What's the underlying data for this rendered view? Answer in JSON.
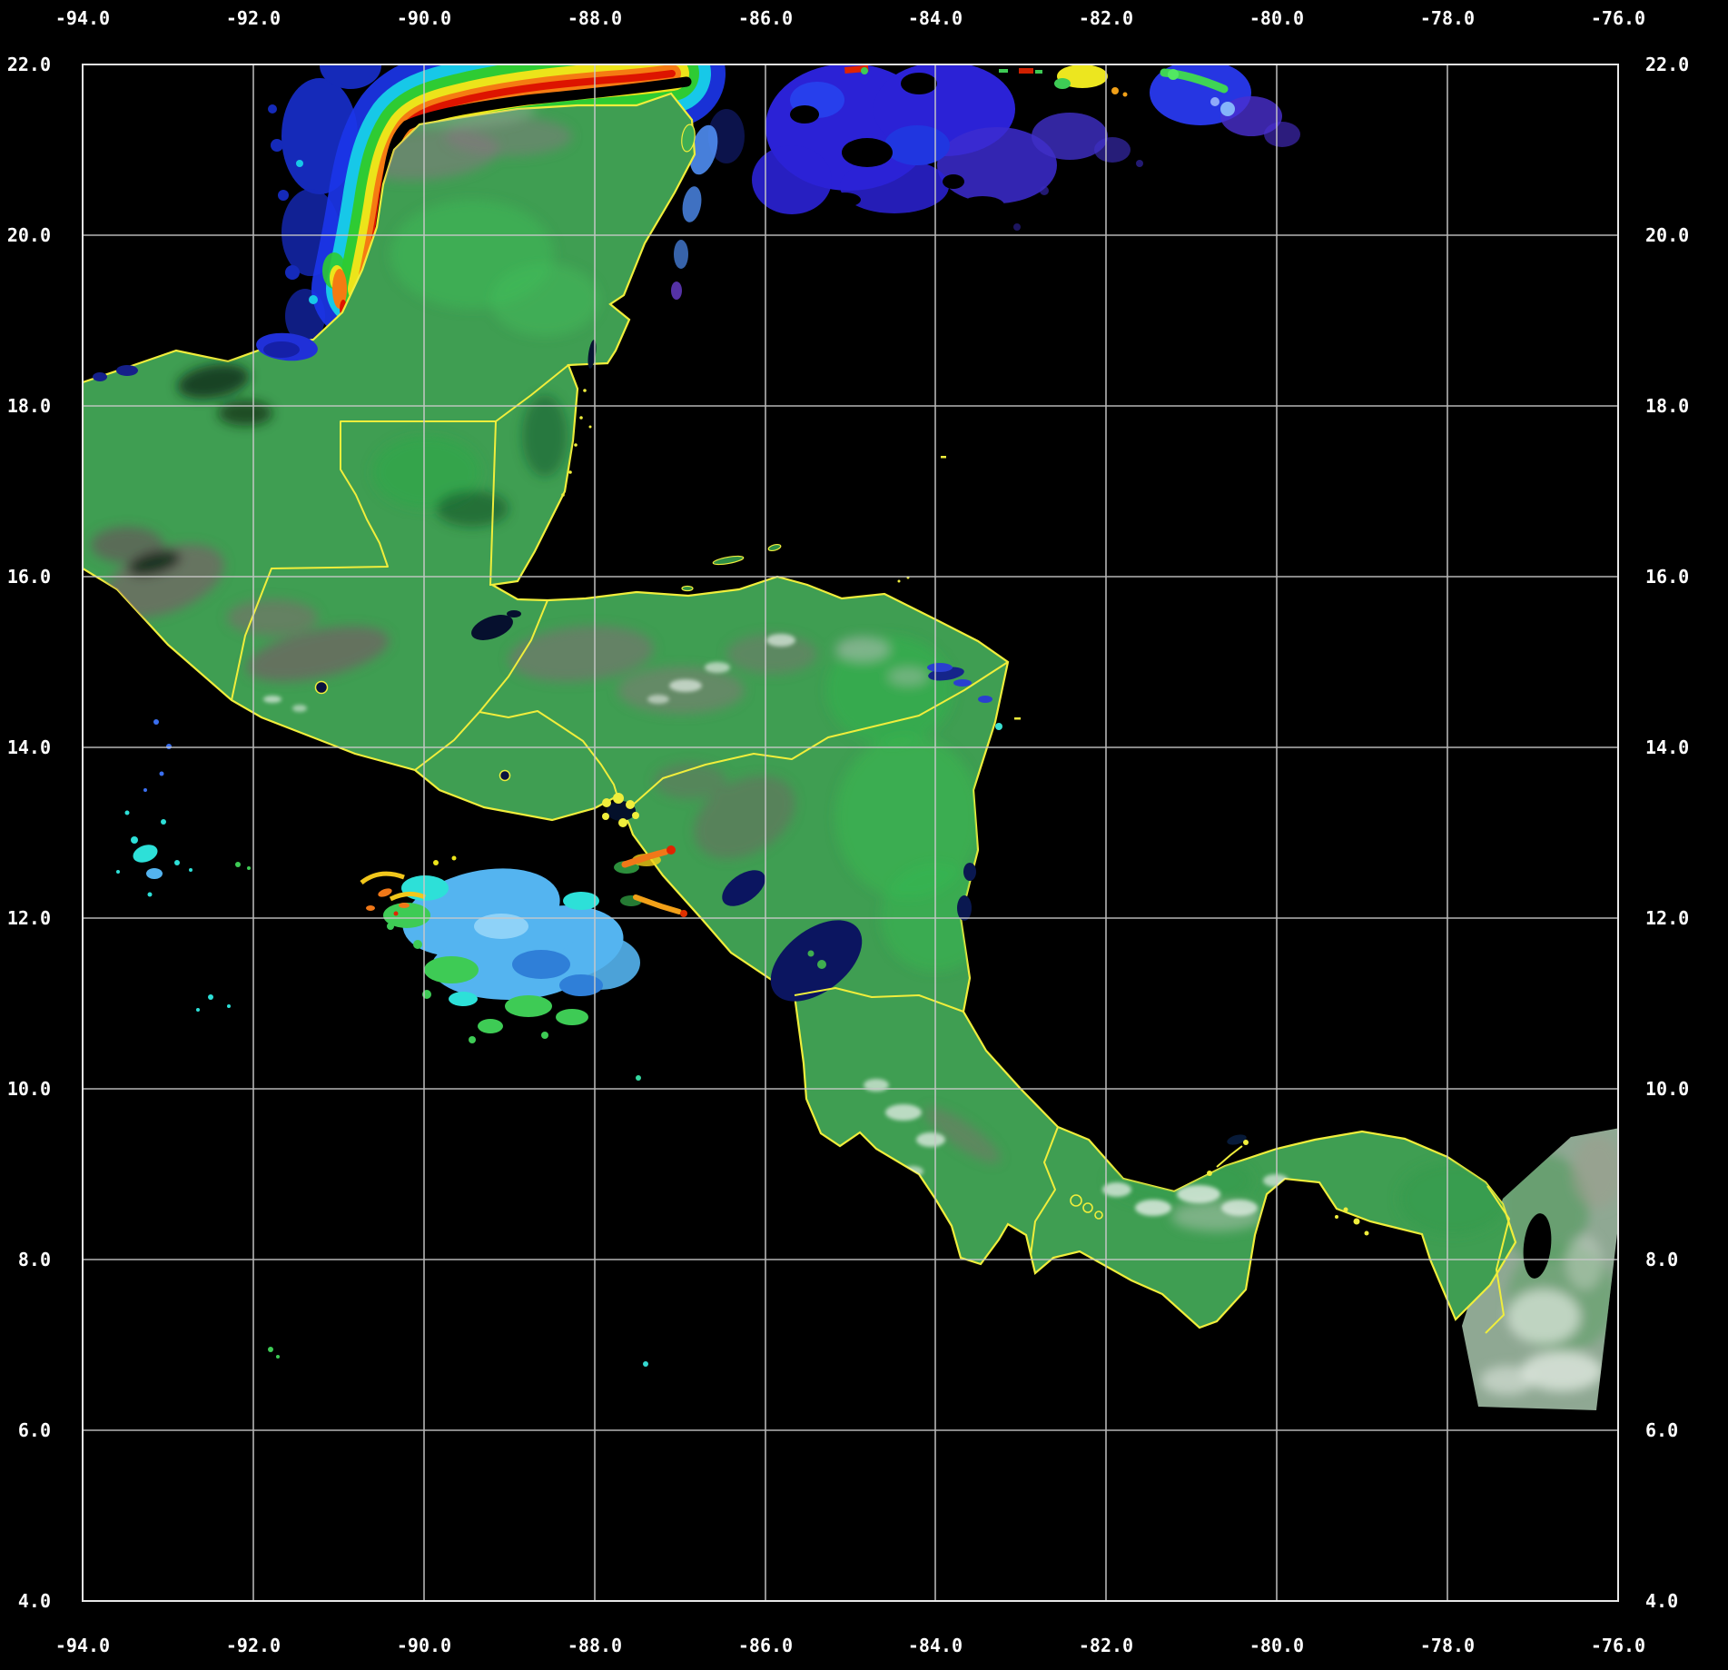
{
  "axes": {
    "top": [
      "-94.0",
      "-92.0",
      "-90.0",
      "-88.0",
      "-86.0",
      "-84.0",
      "-82.0",
      "-80.0",
      "-78.0",
      "-76.0"
    ],
    "bottom": [
      "-94.0",
      "-92.0",
      "-90.0",
      "-88.0",
      "-86.0",
      "-84.0",
      "-82.0",
      "-80.0",
      "-78.0",
      "-76.0"
    ],
    "left": [
      "22.0",
      "20.0",
      "18.0",
      "16.0",
      "14.0",
      "12.0",
      "10.0",
      "8.0",
      "6.0",
      "4.0"
    ],
    "right": [
      "22.0",
      "20.0",
      "18.0",
      "16.0",
      "14.0",
      "12.0",
      "10.0",
      "8.0",
      "6.0",
      "4.0"
    ]
  },
  "colors": {
    "background": "#000000",
    "gridline": "#c9c9c9",
    "plot_border": "#e8e8e8",
    "coastline_border": "#f0ee3c",
    "land_green": "#3f9e52",
    "highland_mauve": "#8a6270",
    "chlorophyll_scale": [
      "#dd1400",
      "#f57b12",
      "#ece41a",
      "#2ecb33",
      "#17c8e8",
      "#1b35e8"
    ],
    "caribbean_patch_blue": "#2b22d6",
    "pacific_patch_blue": "#54b4f0",
    "lake_dark": "#0b1560",
    "swath_gray_green": "#8fa893",
    "cloud_white": "#e6efe8"
  }
}
